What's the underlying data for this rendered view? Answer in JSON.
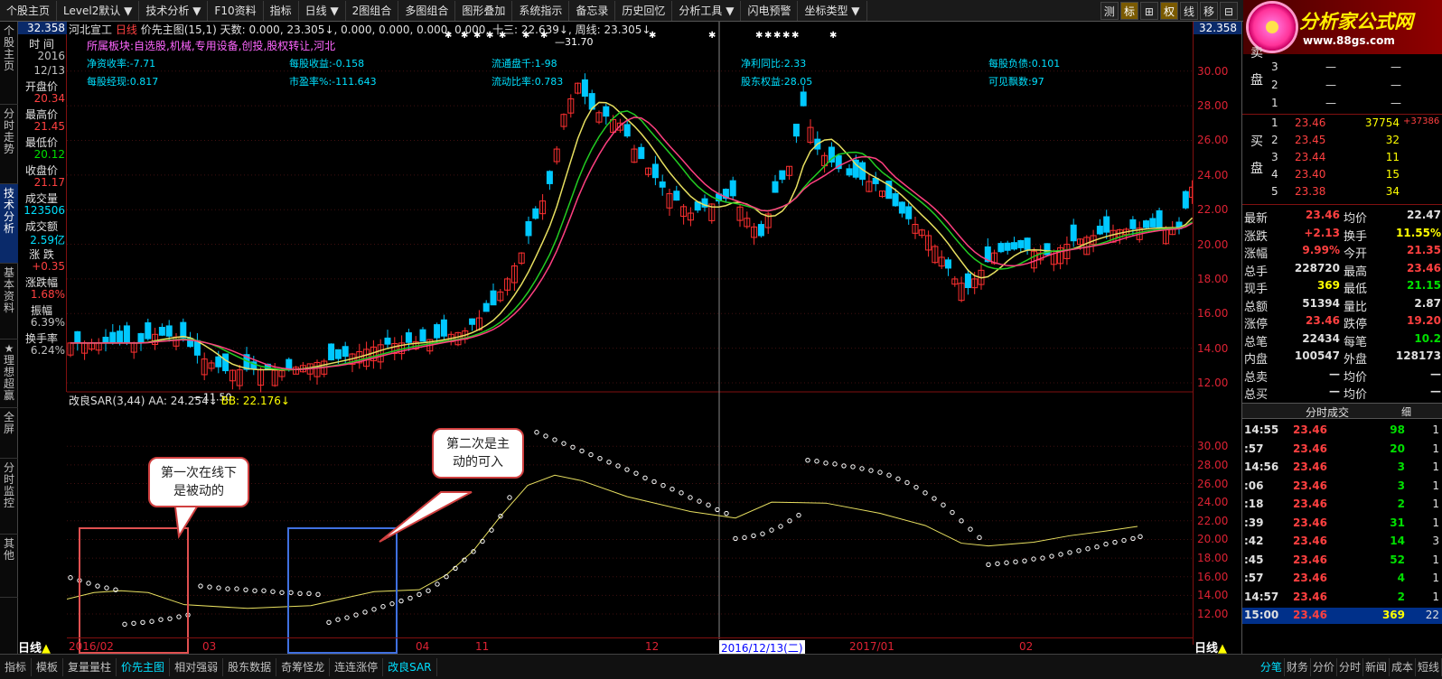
{
  "toolbar": {
    "items": [
      "个股主页",
      "Level2默认",
      "技术分析",
      "F10资料",
      "指标",
      "日线",
      "2图组合",
      "多图组合",
      "图形叠加",
      "系统指示",
      "备忘录",
      "历史回忆",
      "分析工具",
      "闪电预警",
      "坐标类型"
    ],
    "right_buttons": [
      "测",
      "标",
      "⊞",
      "权",
      "线",
      "移",
      "⊟"
    ]
  },
  "logo": {
    "title": "分析家公式网",
    "url": "www.88gs.com"
  },
  "left_tabs": [
    "个股主页",
    "分时走势",
    "技术分析",
    "基本资料",
    "★理想超赢",
    "全屏",
    "分时监控",
    "其他"
  ],
  "info": {
    "price_top": "32.358",
    "items": [
      {
        "label": "时 间",
        "value": "2016"
      },
      {
        "label": "",
        "value": "12/13"
      },
      {
        "label": "开盘价",
        "value": "20.34"
      },
      {
        "label": "最高价",
        "value": "21.45"
      },
      {
        "label": "最低价",
        "value": "20.12"
      },
      {
        "label": "收盘价",
        "value": "21.17"
      },
      {
        "label": "成交量",
        "value": "123506"
      },
      {
        "label": "成交额",
        "value": "2.59亿"
      },
      {
        "label": "涨 跌",
        "value": "+0.35"
      },
      {
        "label": "涨跌幅",
        "value": "1.68%"
      },
      {
        "label": "振幅",
        "value": "6.39%"
      },
      {
        "label": "换手率",
        "value": "6.24%"
      }
    ]
  },
  "main_chart": {
    "title": "河北宣工",
    "period": "日线",
    "indicator": "价先主图(15,1)",
    "days": "天数: 0.000, 23.305↓, 0.000, 0.000, 0.000, 0.000, 十三: 22.639↓, 周线: 23.305↓",
    "fundamentals": {
      "sector": "所属板块:自选股,机械,专用设备,创投,股权转让,河北",
      "r1": [
        "净资收率:-7.71",
        "每股收益:-0.158",
        "流通盘千:1-98",
        "净利同比:2.33",
        "每股负债:0.101"
      ],
      "r2": [
        "每股经现:0.817",
        "市盈率%:-111.643",
        "流动比率:0.783",
        "股东权益:28.05",
        "可见飘数:97"
      ]
    },
    "annot_high": "31.70",
    "annot_low": "11.50",
    "ticks": [
      "30.00",
      "28.00",
      "26.00",
      "24.00",
      "22.00",
      "20.00",
      "18.00",
      "16.00",
      "14.00",
      "12.00"
    ],
    "top_price": "32.358"
  },
  "sub_chart": {
    "title": "改良SAR(3,44)",
    "aa": "AA: 24.254↓",
    "bb": "BB: 22.176↓",
    "ticks": [
      "30.00",
      "28.00",
      "26.00",
      "24.00",
      "22.00",
      "20.00",
      "18.00",
      "16.00",
      "14.00",
      "12.00"
    ]
  },
  "callouts": [
    {
      "text": "第一次在线下是被动的"
    },
    {
      "text": "第二次是主动的可入"
    }
  ],
  "dates": {
    "left_label": "日线",
    "labels": [
      "2016/02",
      "03",
      "04",
      "11",
      "12",
      "2016/12/13(二)",
      "2017/01",
      "02"
    ],
    "right_label": "日线"
  },
  "order_book": {
    "sell": [
      {
        "n": "3",
        "p": "—",
        "v": "—"
      },
      {
        "n": "2",
        "p": "—",
        "v": "—"
      },
      {
        "n": "1",
        "p": "—",
        "v": "—"
      }
    ],
    "buy": [
      {
        "n": "1",
        "p": "23.46",
        "v": "37754",
        "e": "+37386"
      },
      {
        "n": "2",
        "p": "23.45",
        "v": "32",
        "e": ""
      },
      {
        "n": "3",
        "p": "23.44",
        "v": "11",
        "e": ""
      },
      {
        "n": "4",
        "p": "23.40",
        "v": "15",
        "e": ""
      },
      {
        "n": "5",
        "p": "23.38",
        "v": "34",
        "e": ""
      }
    ],
    "sell_label": "卖盘",
    "buy_label": "买盘"
  },
  "quote": [
    {
      "l1": "最新",
      "v1": "23.46",
      "l2": "均价",
      "v2": "22.47"
    },
    {
      "l1": "涨跌",
      "v1": "+2.13",
      "l2": "换手",
      "v2": "11.55%"
    },
    {
      "l1": "涨幅",
      "v1": "9.99%",
      "l2": "今开",
      "v2": "21.35"
    },
    {
      "l1": "总手",
      "v1": "228720",
      "l2": "最高",
      "v2": "23.46"
    },
    {
      "l1": "现手",
      "v1": "369",
      "l2": "最低",
      "v2": "21.15"
    },
    {
      "l1": "总额",
      "v1": "51394",
      "l2": "量比",
      "v2": "2.87"
    },
    {
      "l1": "涨停",
      "v1": "23.46",
      "l2": "跌停",
      "v2": "19.20"
    },
    {
      "l1": "总笔",
      "v1": "22434",
      "l2": "每笔",
      "v2": "10.2"
    },
    {
      "l1": "内盘",
      "v1": "100547",
      "l2": "外盘",
      "v2": "128173"
    },
    {
      "l1": "总卖",
      "v1": "—",
      "l2": "均价",
      "v2": "—"
    },
    {
      "l1": "总买",
      "v1": "—",
      "l2": "均价",
      "v2": "—"
    }
  ],
  "trades_header": "分时成交",
  "trades_tab": "细",
  "trades": [
    {
      "t": "14:55",
      "p": "23.46",
      "v": "98",
      "n": "1"
    },
    {
      "t": ":57",
      "p": "23.46",
      "v": "20",
      "n": "1"
    },
    {
      "t": "14:56",
      "p": "23.46",
      "v": "3",
      "n": "1"
    },
    {
      "t": ":06",
      "p": "23.46",
      "v": "3",
      "n": "1"
    },
    {
      "t": ":18",
      "p": "23.46",
      "v": "2",
      "n": "1"
    },
    {
      "t": ":39",
      "p": "23.46",
      "v": "31",
      "n": "1"
    },
    {
      "t": ":42",
      "p": "23.46",
      "v": "14",
      "n": "3"
    },
    {
      "t": ":45",
      "p": "23.46",
      "v": "52",
      "n": "1"
    },
    {
      "t": ":57",
      "p": "23.46",
      "v": "4",
      "n": "1"
    },
    {
      "t": "14:57",
      "p": "23.46",
      "v": "2",
      "n": "1"
    },
    {
      "t": "15:00",
      "p": "23.46",
      "v": "369",
      "n": "22"
    }
  ],
  "bottom_tabs": [
    "指标",
    "模板",
    "复量量柱",
    "价先主图",
    "相对强弱",
    "股东数据",
    "奇筹怪龙",
    "连连涨停",
    "改良SAR"
  ],
  "right_bottom_tabs": [
    "分笔",
    "财务",
    "分价",
    "分时",
    "新闻",
    "成本",
    "短线"
  ],
  "colors": {
    "up": "#ff3030",
    "down": "#00c8ff",
    "ma_green": "#22cc22",
    "ma_yellow": "#e8e060",
    "ma_pink": "#ff4080",
    "grid": "#801010",
    "axis_text": "#dd2222"
  }
}
